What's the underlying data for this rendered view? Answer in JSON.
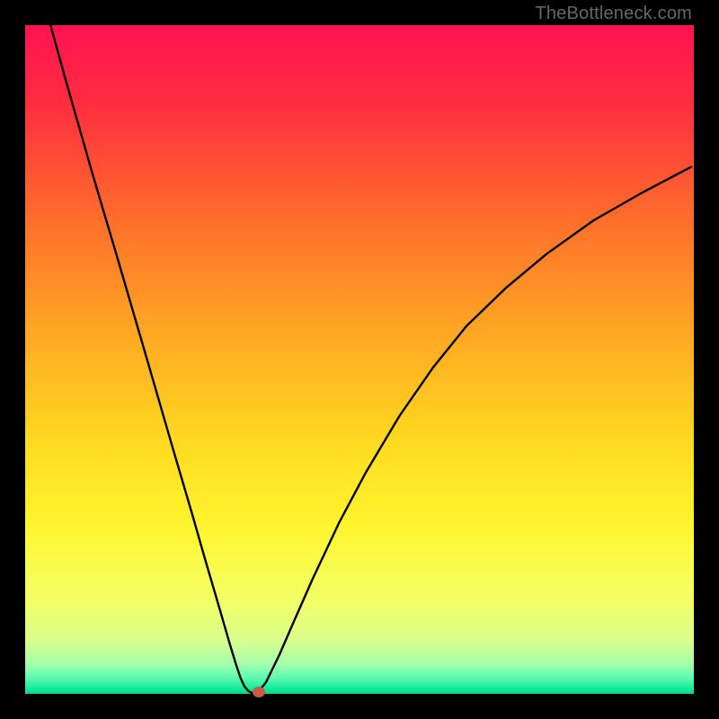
{
  "watermark": "TheBottleneck.com",
  "chart_data": {
    "type": "line",
    "title": "",
    "xlabel": "",
    "ylabel": "",
    "xlim": [
      0,
      100
    ],
    "ylim": [
      0,
      100
    ],
    "series": [
      {
        "name": "bottleneck-curve",
        "x": [
          3.8,
          6,
          10,
          14,
          18,
          22,
          25,
          27,
          29,
          30.5,
          31.5,
          32.2,
          32.8,
          33.4,
          33.9,
          34.3,
          35.1,
          36,
          38,
          40,
          43,
          47,
          51,
          56,
          61,
          66,
          72,
          78,
          85,
          92,
          99.6
        ],
        "values": [
          100,
          92,
          78,
          64.5,
          50.8,
          37,
          26.8,
          19.8,
          13,
          7.8,
          4.5,
          2.4,
          1.1,
          0.4,
          0.15,
          0.1,
          0.6,
          1.7,
          5.8,
          10.4,
          17.2,
          25.7,
          33.2,
          41.6,
          48.8,
          55,
          60.8,
          65.8,
          70.8,
          74.8,
          78.8
        ]
      }
    ],
    "marker": {
      "x": 34.9,
      "y": 0.3
    },
    "background_gradient": {
      "stops": [
        {
          "pos": 0.0,
          "color": "#ff1250"
        },
        {
          "pos": 0.12,
          "color": "#ff2e3f"
        },
        {
          "pos": 0.28,
          "color": "#ff6a2c"
        },
        {
          "pos": 0.45,
          "color": "#ffa423"
        },
        {
          "pos": 0.62,
          "color": "#ffd91f"
        },
        {
          "pos": 0.75,
          "color": "#fff52e"
        },
        {
          "pos": 0.86,
          "color": "#f4ff66"
        },
        {
          "pos": 0.92,
          "color": "#d8ff8c"
        },
        {
          "pos": 0.955,
          "color": "#a6ffad"
        },
        {
          "pos": 0.978,
          "color": "#57f9b0"
        },
        {
          "pos": 0.992,
          "color": "#11eC9c"
        },
        {
          "pos": 1.0,
          "color": "#06d688"
        }
      ]
    }
  }
}
